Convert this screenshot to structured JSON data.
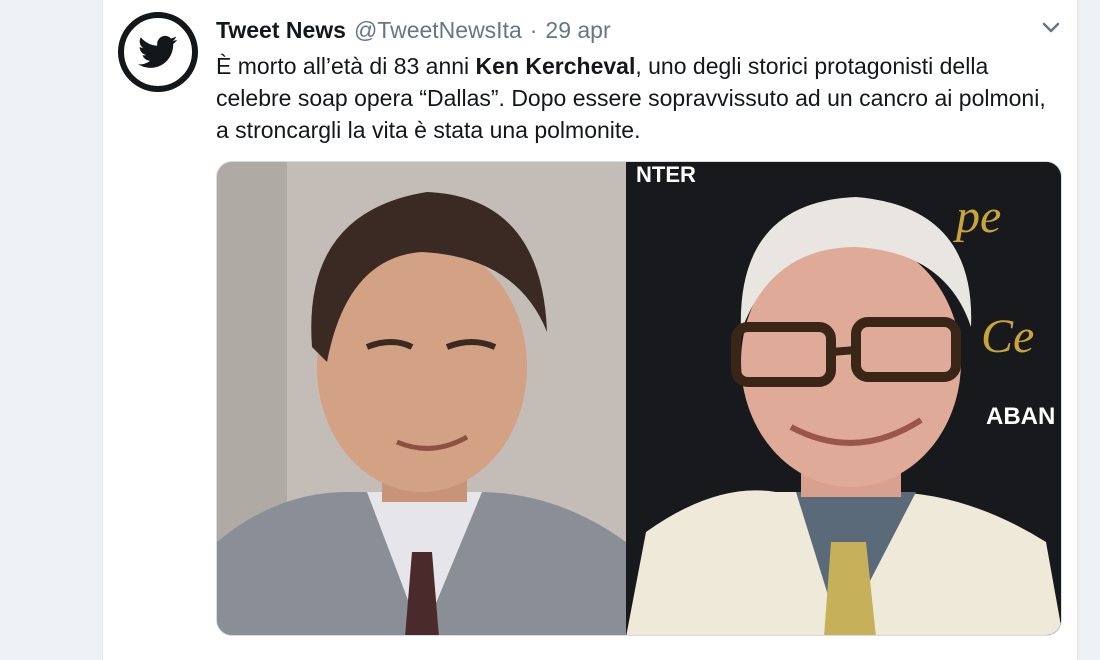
{
  "tweet": {
    "author_name": "Tweet News",
    "handle": "@TweetNewsIta",
    "separator": "·",
    "date": "29 apr",
    "text_before": "È morto all’età di 83 anni ",
    "text_bold": "Ken Kercheval",
    "text_after": ", uno degli storici protagonisti della celebre soap opera “Dallas”. Dopo essere sopravvissuto ad un cancro ai polmoni, a stroncargli la vita è stata una polmonite."
  },
  "media": {
    "right_signage": [
      "NTER",
      "pe",
      "Ce",
      "ABAN"
    ]
  },
  "icons": {
    "avatar": "twitter-bird-icon",
    "menu": "chevron-down-icon"
  },
  "colors": {
    "text": "#14171a",
    "secondary": "#657786",
    "background": "#e6ecf0",
    "card": "#ffffff"
  }
}
